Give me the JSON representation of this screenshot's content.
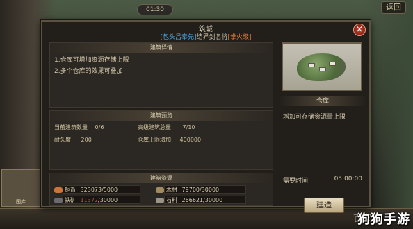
{
  "top": {
    "pill_text": "01:30",
    "top_right_label": "返回"
  },
  "dialog": {
    "title": "筑城",
    "subtitle_hero": "[包头吕奉先]",
    "subtitle_mid": "结界剑名将",
    "subtitle_tag": "[拳火级]",
    "close_label": "×"
  },
  "details": {
    "heading": "建筑详情",
    "lines": [
      "1.仓库可增加资源存储上限",
      "2.多个仓库的效果可叠加"
    ]
  },
  "preview": {
    "heading": "建筑预览",
    "current_count_label": "当前建筑数量",
    "current_count_value": "0/6",
    "advanced_label": "高级建筑总量",
    "advanced_value": "7/10",
    "durability_label": "耐久度",
    "durability_value": "200",
    "storage_label": "仓库上限增加",
    "storage_value": "400000"
  },
  "resources": {
    "heading": "建筑资源",
    "items": [
      {
        "name": "铜币",
        "value": "323073/5000",
        "icon_color": "#c8743a",
        "value_color": "#d4c8ac"
      },
      {
        "name": "木材",
        "value": "79700/30000",
        "icon_color": "#a08a60",
        "value_color": "#d4c8ac"
      },
      {
        "name": "铁矿",
        "value": "11372/30000",
        "icon_color": "#6a6a70",
        "value_color": "#d44a3a",
        "value_highlight": "11372",
        "value_rest": "/30000"
      },
      {
        "name": "石料",
        "value": "266621/30000",
        "icon_color": "#9a9484",
        "value_color": "#d4c8ac"
      }
    ]
  },
  "building": {
    "name": "仓库",
    "description": "增加可存储资源量上限",
    "time_label": "需要时间",
    "time_value": "05:00:00",
    "build_button": "建造"
  },
  "sidebar": {
    "thumb_label": "国库"
  },
  "bottom": {
    "text": "百家",
    "watermark": "狗狗手游"
  }
}
